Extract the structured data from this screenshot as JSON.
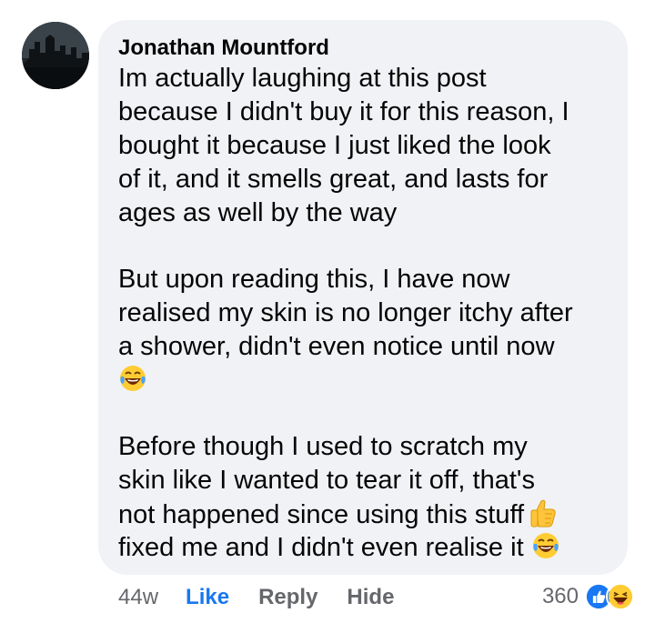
{
  "comment": {
    "author": "Jonathan Mountford",
    "lines": [
      "Im actually laughing at this post",
      "because I didn't buy it for this reason, I",
      "bought it because I just liked the look",
      "of it, and it smells great, and lasts for",
      "ages as well by the way"
    ],
    "lines2": [
      "But upon reading this, I have now",
      "realised my skin is no longer itchy after",
      "a shower, didn't even notice until now"
    ],
    "lines3": [
      "Before though I used to scratch my",
      "skin like I wanted to tear it off, that's",
      "not happened since using this stuff",
      "fixed me and I didn't even realise it"
    ]
  },
  "actions": {
    "timestamp": "44w",
    "like": "Like",
    "reply": "Reply",
    "hide": "Hide"
  },
  "reactions": {
    "count": "360",
    "types": [
      "like-icon",
      "haha-icon"
    ]
  },
  "colors": {
    "bubble": "#f0f2f5",
    "like_blue": "#1877f2",
    "meta_gray": "#65676b"
  }
}
